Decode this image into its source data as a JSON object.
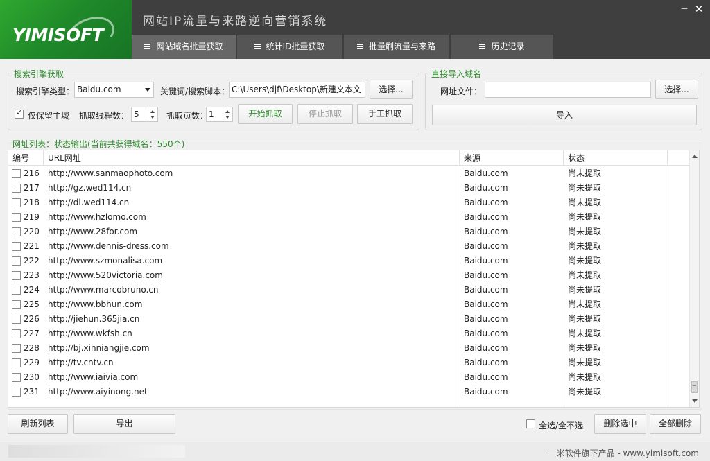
{
  "app": {
    "logo_text": "YIMISOFT",
    "title": "网站IP流量与来路逆向营销系统",
    "minimize_icon": "minimize-icon",
    "close_icon": "close-icon"
  },
  "tabs": [
    {
      "label": "网站域名批量获取",
      "active": true
    },
    {
      "label": "统计ID批量获取",
      "active": false
    },
    {
      "label": "批量刷流量与来路",
      "active": false
    },
    {
      "label": "历史记录",
      "active": false
    }
  ],
  "search_group": {
    "title": "搜索引擎获取",
    "engine_label": "搜索引擎类型：",
    "engine_value": "Baidu.com",
    "keyword_label": "关键词/搜索脚本：",
    "keyword_value": "C:\\Users\\djf\\Desktop\\新建文本文",
    "choose_button": "选择...",
    "main_domain_label": "仅保留主域",
    "main_domain_checked": true,
    "threads_label": "抓取线程数：",
    "threads_value": "5",
    "pages_label": "抓取页数：",
    "pages_value": "1",
    "start_button": "开始抓取",
    "stop_button": "停止抓取",
    "manual_button": "手工抓取"
  },
  "import_group": {
    "title": "直接导入域名",
    "file_label": "网址文件：",
    "file_value": "",
    "choose_button": "选择...",
    "import_button": "导入"
  },
  "list": {
    "title": "网址列表：状态输出(当前共获得域名：550个)",
    "columns": [
      "编号",
      "URL网址",
      "来源",
      "状态"
    ],
    "rows": [
      {
        "id": "216",
        "url": "http://www.sanmaophoto.com",
        "source": "Baidu.com",
        "status": "尚未提取"
      },
      {
        "id": "217",
        "url": "http://gz.wed114.cn",
        "source": "Baidu.com",
        "status": "尚未提取"
      },
      {
        "id": "218",
        "url": "http://dl.wed114.cn",
        "source": "Baidu.com",
        "status": "尚未提取"
      },
      {
        "id": "219",
        "url": "http://www.hzlomo.com",
        "source": "Baidu.com",
        "status": "尚未提取"
      },
      {
        "id": "220",
        "url": "http://www.28for.com",
        "source": "Baidu.com",
        "status": "尚未提取"
      },
      {
        "id": "221",
        "url": "http://www.dennis-dress.com",
        "source": "Baidu.com",
        "status": "尚未提取"
      },
      {
        "id": "222",
        "url": "http://www.szmonalisa.com",
        "source": "Baidu.com",
        "status": "尚未提取"
      },
      {
        "id": "223",
        "url": "http://www.520victoria.com",
        "source": "Baidu.com",
        "status": "尚未提取"
      },
      {
        "id": "224",
        "url": "http://www.marcobruno.cn",
        "source": "Baidu.com",
        "status": "尚未提取"
      },
      {
        "id": "225",
        "url": "http://www.bbhun.com",
        "source": "Baidu.com",
        "status": "尚未提取"
      },
      {
        "id": "226",
        "url": "http://jiehun.365jia.cn",
        "source": "Baidu.com",
        "status": "尚未提取"
      },
      {
        "id": "227",
        "url": "http://www.wkfsh.cn",
        "source": "Baidu.com",
        "status": "尚未提取"
      },
      {
        "id": "228",
        "url": "http://bj.xinniangjie.com",
        "source": "Baidu.com",
        "status": "尚未提取"
      },
      {
        "id": "229",
        "url": "http://tv.cntv.cn",
        "source": "Baidu.com",
        "status": "尚未提取"
      },
      {
        "id": "230",
        "url": "http://www.iaivia.com",
        "source": "Baidu.com",
        "status": "尚未提取"
      },
      {
        "id": "231",
        "url": "http://www.aiyinong.net",
        "source": "Baidu.com",
        "status": "尚未提取"
      }
    ]
  },
  "bottom": {
    "refresh_button": "刷新列表",
    "export_button": "导出",
    "select_all_label": "全选/全不选",
    "delete_selected_button": "删除选中",
    "delete_all_button": "全部删除"
  },
  "footer": {
    "text": "一米软件旗下产品 - www.yimisoft.com"
  },
  "colors": {
    "accent_green": "#2d8a2d",
    "titlebar": "#3f3f3f",
    "tab_active": "#676767"
  }
}
